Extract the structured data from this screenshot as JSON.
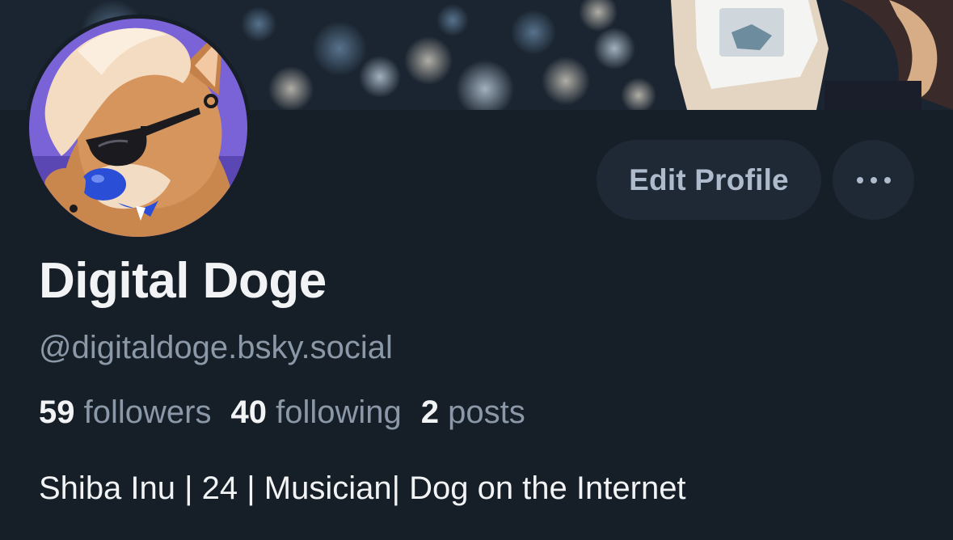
{
  "profile": {
    "display_name": "Digital Doge",
    "handle": "@digitaldoge.bsky.social",
    "bio": "Shiba Inu | 24 | Musician| Dog on the Internet"
  },
  "stats": {
    "followers_count": "59",
    "followers_label": "followers",
    "following_count": "40",
    "following_label": "following",
    "posts_count": "2",
    "posts_label": "posts"
  },
  "actions": {
    "edit_profile_label": "Edit Profile",
    "more_icon": "ellipsis-icon"
  },
  "colors": {
    "background": "#161e27",
    "button_bg": "#1e2935",
    "primary_text": "#f1f3f5",
    "secondary_text": "#8b98a8",
    "button_text": "#aebbcc"
  }
}
